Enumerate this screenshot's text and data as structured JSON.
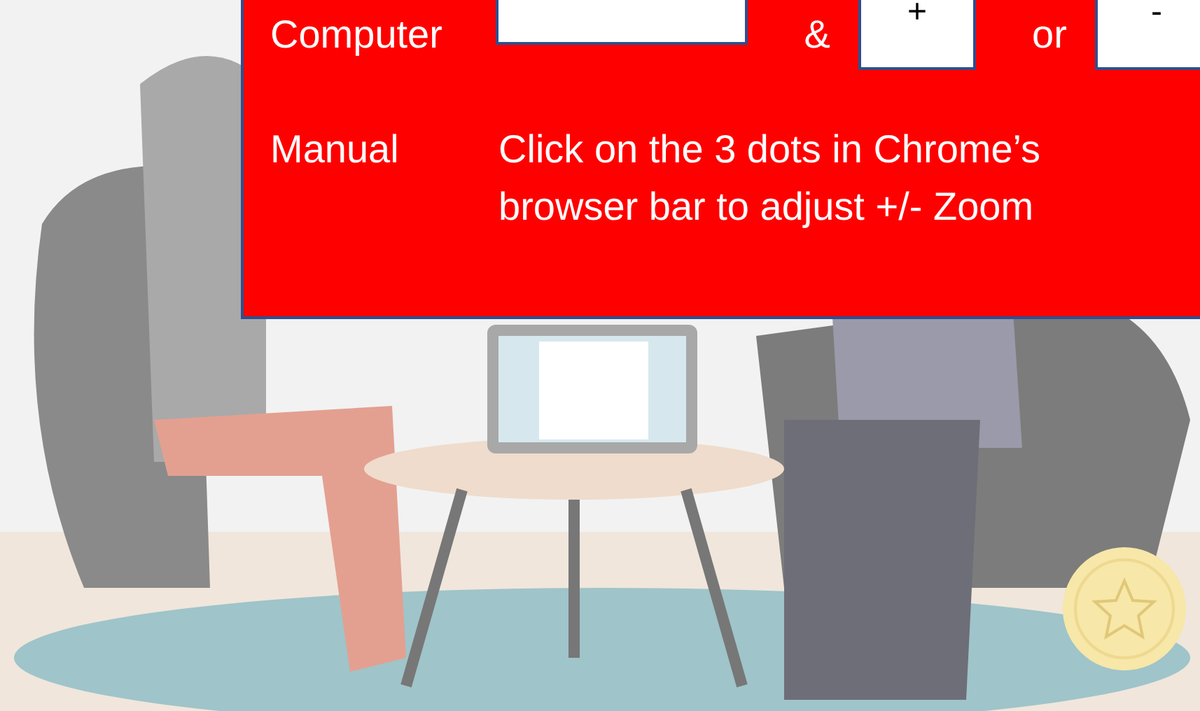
{
  "instructions": [
    {
      "kind": "keys",
      "label": "Computer",
      "items": [
        {
          "kind": "key"
        },
        {
          "kind": "text",
          "text": "&"
        },
        {
          "kind": "key",
          "text": "+"
        },
        {
          "kind": "text",
          "text": "or"
        },
        {
          "kind": "key",
          "text": "-"
        }
      ]
    },
    {
      "kind": "text",
      "label": "Manual",
      "lines": [
        "Click on the 3 dots in Chrome’s",
        "browser bar to adjust +/- Zoom"
      ]
    }
  ]
}
